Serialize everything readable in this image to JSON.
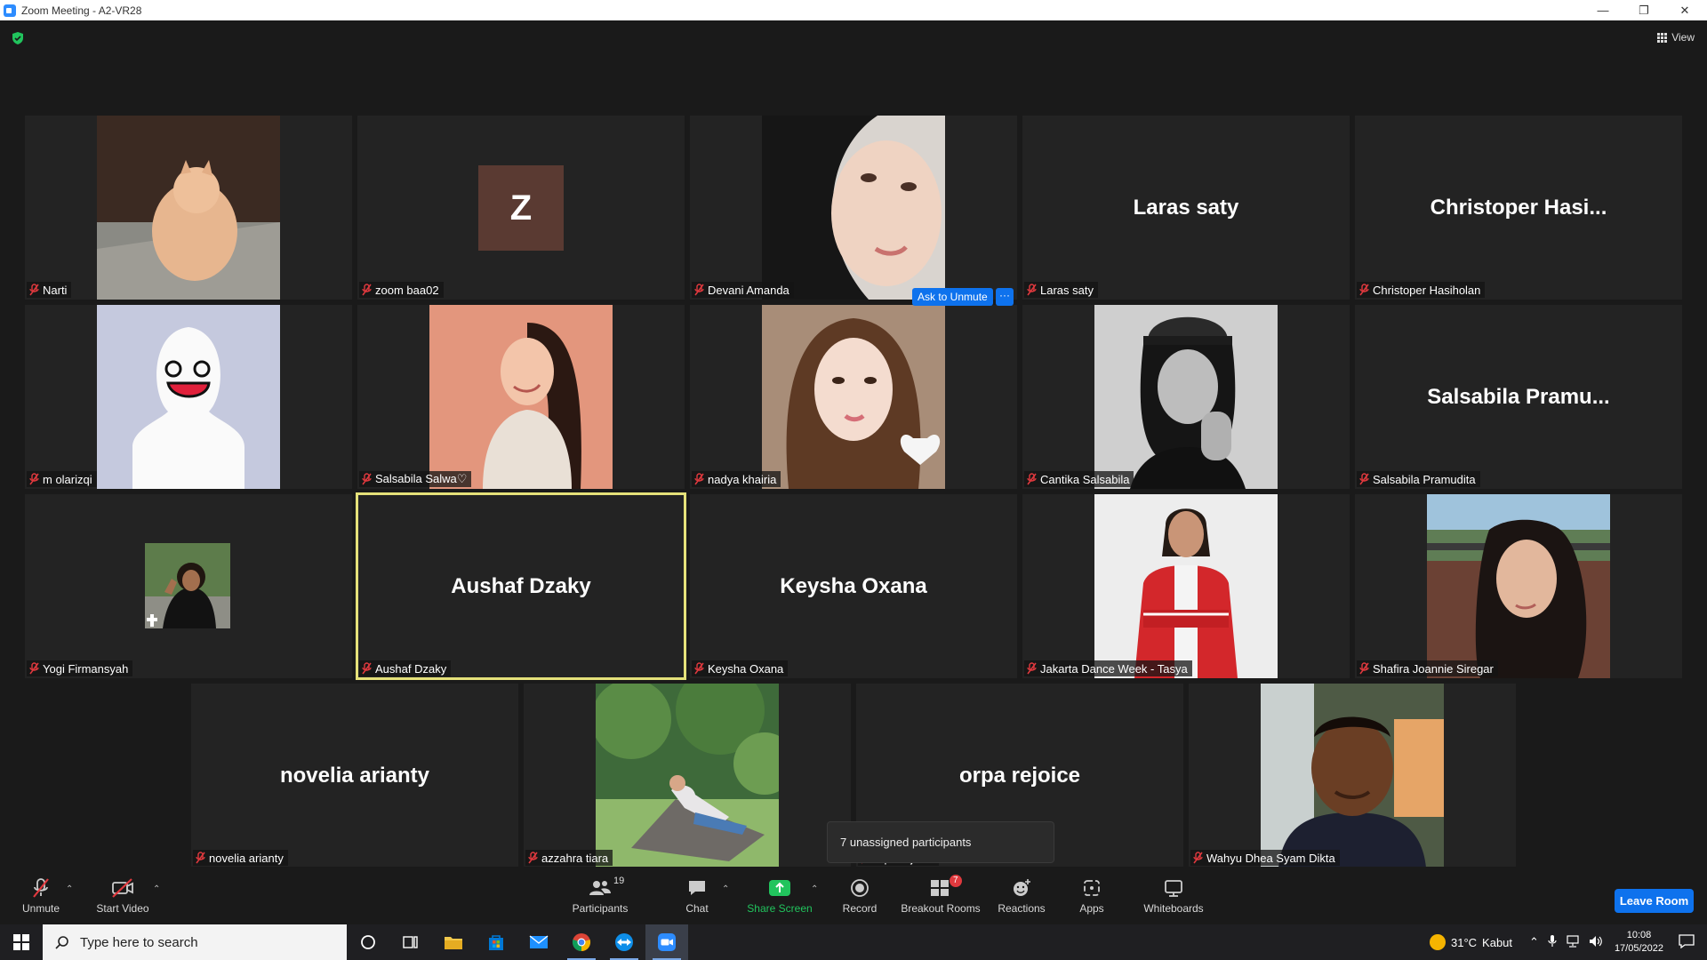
{
  "window": {
    "title": "Zoom Meeting - A2-VR28"
  },
  "stage": {
    "view_label": "View"
  },
  "tiles": [
    {
      "name": "Narti",
      "kind": "photo",
      "photo": "cat"
    },
    {
      "name": "zoom baa02",
      "kind": "avatar",
      "initial": "Z"
    },
    {
      "name": "Devani Amanda",
      "kind": "photo",
      "photo": "hijab"
    },
    {
      "name": "Laras saty",
      "kind": "text",
      "big": "Laras saty"
    },
    {
      "name": "Christoper Hasiholan",
      "kind": "text",
      "big": "Christoper  Hasi..."
    },
    {
      "name": "m olarizqi",
      "kind": "photo",
      "photo": "meme"
    },
    {
      "name": "Salsabila Salwa♡",
      "kind": "photo",
      "photo": "pink"
    },
    {
      "name": "nadya khairia",
      "kind": "photo",
      "photo": "girl"
    },
    {
      "name": "Cantika Salsabila",
      "kind": "photo",
      "photo": "bw"
    },
    {
      "name": "Salsabila Pramudita",
      "kind": "text",
      "big": "Salsabila  Pramu..."
    },
    {
      "name": "Yogi Firmansyah",
      "kind": "small-photo",
      "photo": "yogi"
    },
    {
      "name": "Aushaf Dzaky",
      "kind": "text",
      "big": "Aushaf Dzaky",
      "active": true
    },
    {
      "name": "Keysha Oxana",
      "kind": "text",
      "big": "Keysha Oxana"
    },
    {
      "name": "Jakarta Dance Week - Tasya",
      "kind": "photo",
      "photo": "red"
    },
    {
      "name": "Shafira Joannie Siregar",
      "kind": "photo",
      "photo": "outdoor"
    },
    {
      "name": "novelia arianty",
      "kind": "text",
      "big": "novelia arianty"
    },
    {
      "name": "azzahra tiara",
      "kind": "photo",
      "photo": "garden"
    },
    {
      "name": "orpa rejoice",
      "kind": "text",
      "big": "orpa rejoice"
    },
    {
      "name": "Wahyu Dhea Syam Dikta",
      "kind": "photo",
      "photo": "guy"
    }
  ],
  "ask_unmute": {
    "label": "Ask to Unmute",
    "more": "···"
  },
  "tooltip": {
    "unassigned": "7 unassigned participants"
  },
  "toolbar": {
    "unmute": "Unmute",
    "start_video": "Start Video",
    "participants": "Participants",
    "participants_count": "19",
    "chat": "Chat",
    "share_screen": "Share Screen",
    "record": "Record",
    "breakout_rooms": "Breakout Rooms",
    "breakout_badge": "7",
    "reactions": "Reactions",
    "apps": "Apps",
    "whiteboards": "Whiteboards",
    "leave_room": "Leave Room"
  },
  "taskbar": {
    "search_placeholder": "Type here to search",
    "weather_temp": "31°C",
    "weather_desc": "Kabut",
    "time": "10:08",
    "date": "17/05/2022"
  },
  "colors": {
    "accent": "#0e72ed",
    "active_speaker": "#e5e17a",
    "share_green": "#21c45d",
    "mute_red": "#e0393e"
  }
}
